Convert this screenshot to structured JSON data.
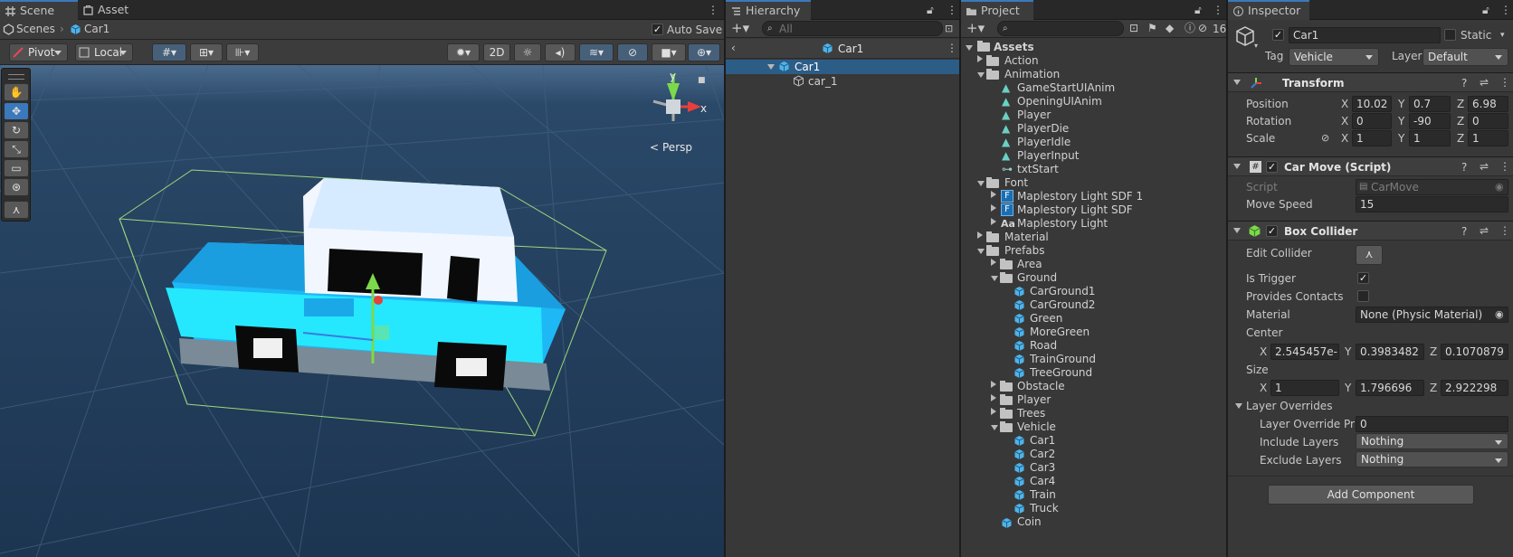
{
  "scene_panel": {
    "tabs": [
      "Scene",
      "Asset Store"
    ],
    "breadcrumb_root": "Scenes",
    "breadcrumb_object": "Car1",
    "auto_save_label": "Auto Save",
    "pivot_label": "Pivot",
    "local_label": "Local",
    "mode_2d_label": "2D",
    "persp_label": "Persp",
    "gizmo_y": "y",
    "gizmo_x": "x"
  },
  "hierarchy": {
    "tab": "Hierarchy",
    "search_placeholder": "All",
    "scene_object": "Car1",
    "items": [
      "Car1",
      "car_1"
    ]
  },
  "project": {
    "tab": "Project",
    "hidden_count": "16",
    "root": "Assets",
    "items": [
      "Action",
      "Animation",
      "GameStartUIAnim",
      "OpeningUIAnim",
      "Player",
      "PlayerDie",
      "PlayerIdle",
      "PlayerInput",
      "txtStart",
      "Font",
      "Maplestory Light SDF 1",
      "Maplestory Light SDF",
      "Maplestory Light",
      "Material",
      "Prefabs",
      "Area",
      "Ground",
      "CarGround1",
      "CarGround2",
      "Green",
      "MoreGreen",
      "Road",
      "TrainGround",
      "TreeGround",
      "Obstacle",
      "Player",
      "Trees",
      "Vehicle",
      "Car1",
      "Car2",
      "Car3",
      "Car4",
      "Train",
      "Truck",
      "Coin"
    ]
  },
  "inspector": {
    "tab": "Inspector",
    "object_name": "Car1",
    "static_label": "Static",
    "tag_label": "Tag",
    "tag_value": "Vehicle",
    "layer_label": "Layer",
    "layer_value": "Default",
    "transform": {
      "title": "Transform",
      "position_label": "Position",
      "rotation_label": "Rotation",
      "scale_label": "Scale",
      "x": "X",
      "y": "Y",
      "z": "Z",
      "position": [
        "10.02",
        "0.7",
        "6.98"
      ],
      "rotation": [
        "0",
        "-90",
        "0"
      ],
      "scale": [
        "1",
        "1",
        "1"
      ]
    },
    "car_move": {
      "title": "Car Move (Script)",
      "script_label": "Script",
      "script_value": "CarMove",
      "speed_label": "Move Speed",
      "speed_value": "15"
    },
    "box_collider": {
      "title": "Box Collider",
      "edit_label": "Edit Collider",
      "trigger_label": "Is Trigger",
      "contacts_label": "Provides Contacts",
      "material_label": "Material",
      "material_value": "None (Physic Material)",
      "center_label": "Center",
      "center": [
        "2.545457e-",
        "0.3983482",
        "0.1070879"
      ],
      "size_label": "Size",
      "size": [
        "1",
        "1.796696",
        "2.922298"
      ],
      "overrides_label": "Layer Overrides",
      "priority_label": "Layer Override Pric",
      "priority_value": "0",
      "include_label": "Include Layers",
      "include_value": "Nothing",
      "exclude_label": "Exclude Layers",
      "exclude_value": "Nothing"
    },
    "add_component": "Add Component"
  },
  "colors": {
    "accent": "#3a79bb",
    "selection": "#2c5d87",
    "scene_bg": "#1f3a55",
    "car": "#1bd2ff"
  }
}
